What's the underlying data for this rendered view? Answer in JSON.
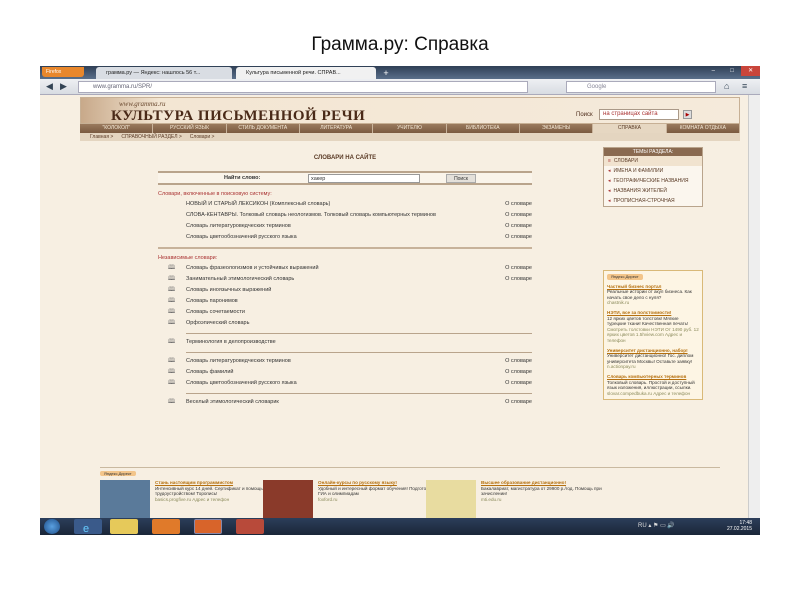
{
  "slide": {
    "title": "Грамма.ру: Справка"
  },
  "browser": {
    "menu_button": "Firefox",
    "tabs": [
      {
        "label": "грамма.ру — Яндекс: нашлось 56 т..."
      },
      {
        "label": "Культура письменной речи. СПРАВ..."
      }
    ],
    "url": "www.gramma.ru/SPR/",
    "search_placeholder": "Google"
  },
  "site": {
    "url": "www.gramma.ru",
    "name": "КУЛЬТУРА ПИСЬМЕННОЙ РЕЧИ",
    "search_label": "Поиск",
    "search_value": "на страницах сайта",
    "menu": [
      "\"КОЛОКОЛ\"",
      "РУССКИЙ ЯЗЫК",
      "СТИЛЬ ДОКУМЕНТА",
      "ЛИТЕРАТУРА",
      "УЧИТЕЛЮ",
      "БИБЛИОТЕКА",
      "ЭКЗАМЕНЫ",
      "СПРАВКА",
      "КОМНАТА ОТДЫХА"
    ],
    "breadcrumbs": [
      "Главная  >",
      "СПРАВОЧНЫЙ РАЗДЕЛ  >",
      "Словари  >"
    ]
  },
  "main": {
    "title": "СЛОВАРИ НА САЙТЕ",
    "find_label": "Найти слово:",
    "find_value": "хакер",
    "find_button": "Поиск",
    "section1": "Словари, включенные в поисковую систему:",
    "section1_items": [
      {
        "name": "НОВЫЙ И СТАРЫЙ ЛЕКСИКОН (Комплексный словарь)",
        "about": "О словаре"
      },
      {
        "name": "СЛОВА-КЕНТАВРЫ. Толковый словарь неологизмов. Толковый словарь компьютерных терминов",
        "about": "О словаре"
      },
      {
        "name": "Словарь литературоведческих терминов",
        "about": "О словаре"
      },
      {
        "name": "Словарь цветообозначений русского языка",
        "about": "О словаре"
      }
    ],
    "section2": "Независимые словари:",
    "groups": [
      [
        {
          "name": "Словарь фразеологизмов и устойчивых выражений",
          "about": "О словаре"
        },
        {
          "name": "Занимательный этимологический словарь",
          "about": "О словаре"
        },
        {
          "name": "Словарь иноязычных выражений"
        },
        {
          "name": "Словарь паронимов"
        },
        {
          "name": "Словарь сочетаемости"
        },
        {
          "name": "Орфоэпический словарь"
        }
      ],
      [
        {
          "name": "Терминология в делопроизводстве"
        }
      ],
      [
        {
          "name": "Словарь литературоведческих терминов",
          "about": "О словаре"
        },
        {
          "name": "Словарь фамилий",
          "about": "О словаре"
        },
        {
          "name": "Словарь цветообозначений русского языка",
          "about": "О словаре"
        }
      ],
      [
        {
          "name": "Веселый этимологический словарик",
          "about": "О словаре"
        }
      ]
    ]
  },
  "sidebar": {
    "title": "ТЕМЫ РАЗДЕЛА:",
    "items": [
      "СЛОВАРИ",
      "ИМЕНА И ФАМИЛИИ",
      "ГЕОГРАФИЧЕСКИЕ НАЗВАНИЯ",
      "НАЗВАНИЯ ЖИТЕЛЕЙ",
      "ПРОПИСНАЯ-СТРОЧНАЯ"
    ]
  },
  "ads": {
    "label": "Яндекс.Директ",
    "items": [
      {
        "title": "Частный бизнес портал",
        "text": "Реальные истории от акул бизнеса. Как начать свое дело с нуля?",
        "url": "chastnik.ru"
      },
      {
        "title": "НЭТИ, все за полстоимости!",
        "text": "12 ярких цветов толстовк! Мягкие турецкие ткани! Качественная печать!",
        "url": "Смотреть толстовки НЭТИ  От 1490 руб.  12 ярких цветов  1.5hview.com  Адрес и телефон"
      },
      {
        "title": "Университет дистанционно, набор!",
        "text": "Университет дистанционно! Гос. диплом университета Москвы! Оставьте заявку!",
        "url": "n.actionpay.ru"
      },
      {
        "title": "Словарь компьютерных терминов",
        "text": "Толковый словарь. Простой и доступный язык изложения, иллюстрации, ссылки.",
        "url": "slovar.compedbuka.ru  Адрес и телефон"
      }
    ],
    "bottom": [
      {
        "title": "Стань настоящим программистом",
        "text": "Интенсивный курс 14 дней. Сертификат и помощь с трудоустройством! Торопись!",
        "url": "basics.progfive.ru  Адрес и телефон"
      },
      {
        "title": "Онлайн-курсы по русскому языку!",
        "text": "Удобный и интересный формат обучения! Подготовки к ЕГЭ, ГИА и олимпиадам",
        "url": "foxford.ru"
      },
      {
        "title": "Высшее образование дистанционно!",
        "text": "Бакалавриат, магистратура от 29900 р./год. Помощь при зачислении!",
        "url": "mti.edu.ru"
      }
    ]
  },
  "taskbar": {
    "lang": "RU",
    "time": "17:48",
    "date": "27.02.2015"
  }
}
